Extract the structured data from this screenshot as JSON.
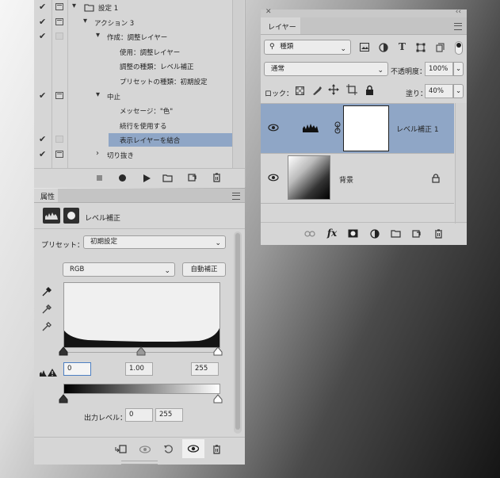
{
  "actions_panel": {
    "rows": [
      {
        "label": "設定 1",
        "check": true,
        "dialog": "on",
        "twisty": "▾",
        "folder": true,
        "indent": 0
      },
      {
        "label": "アクション 3",
        "check": true,
        "dialog": "on",
        "twisty": "▾",
        "folder": false,
        "indent": 1
      },
      {
        "label": "作成：調整レイヤー",
        "check": true,
        "dialog": "empty",
        "twisty": "▾",
        "indent": 2
      },
      {
        "label": "使用：調整レイヤー",
        "check": false,
        "dialog": "none",
        "twisty": "",
        "indent": 3
      },
      {
        "label": "調整の種類：レベル補正",
        "check": false,
        "dialog": "none",
        "twisty": "",
        "indent": 3
      },
      {
        "label": "プリセットの種類：初期設定",
        "check": false,
        "dialog": "none",
        "twisty": "",
        "indent": 3
      },
      {
        "label": "中止",
        "check": true,
        "dialog": "on",
        "twisty": "▾",
        "indent": 2
      },
      {
        "label": "メッセージ：\"色\"",
        "check": false,
        "dialog": "none",
        "twisty": "",
        "indent": 3
      },
      {
        "label": "続行を使用する",
        "check": false,
        "dialog": "none",
        "twisty": "",
        "indent": 3
      },
      {
        "label": "表示レイヤーを結合",
        "check": true,
        "dialog": "empty",
        "twisty": "",
        "indent": 3,
        "selected": true
      },
      {
        "label": "切り抜き",
        "check": true,
        "dialog": "on",
        "twisty": "›",
        "indent": 2
      }
    ]
  },
  "properties_panel": {
    "tab_label": "属性",
    "adjustment_title": "レベル補正",
    "preset_label": "プリセット：",
    "preset_value": "初期設定",
    "channel_value": "RGB",
    "auto_label": "自動補正",
    "input_black": "0",
    "input_gamma": "1.00",
    "input_white": "255",
    "output_label": "出力レベル：",
    "output_black": "0",
    "output_white": "255"
  },
  "layers_panel": {
    "tab_label": "レイヤー",
    "filter_kind": "種類",
    "blend_mode": "通常",
    "opacity_label": "不透明度：",
    "opacity_value": "100%",
    "lock_label": "ロック：",
    "fill_label": "塗り：",
    "fill_value": "40%",
    "layers": [
      {
        "name": "レベル補正 1",
        "selected": true
      },
      {
        "name": "背景",
        "selected": false
      }
    ]
  },
  "colors": {
    "selection": "#8fa6c6",
    "panel": "#d6d6d6"
  }
}
